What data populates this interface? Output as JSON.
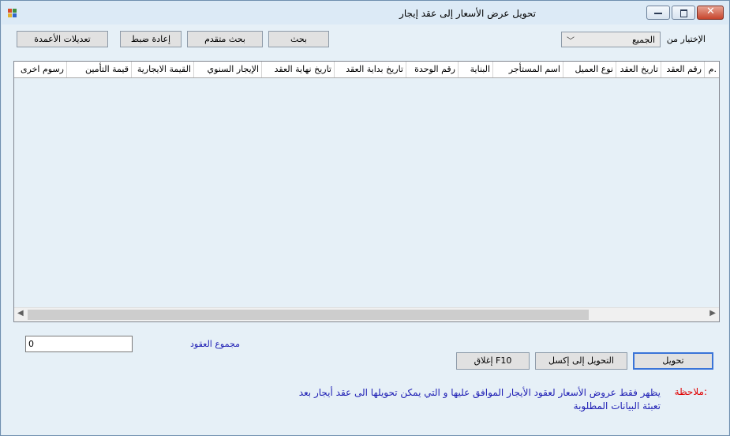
{
  "window": {
    "title": "تحويل عرض الأسعار إلى عقد إيجار"
  },
  "toolbar": {
    "column_edits_label": "تعديلات الأعمدة",
    "reset_label": "إعادة ضبط",
    "advanced_search_label": "بحث متقدم",
    "search_label": "بحث"
  },
  "filter": {
    "label": "الإختيار من",
    "selected": "الجميع"
  },
  "table": {
    "columns": [
      "م.",
      "رقم العقد",
      "تاريخ العقد",
      "نوع العميل",
      "اسم المستأجر",
      "البناية",
      "رقم الوحدة",
      "تاريخ بداية العقد",
      "تاريخ نهاية العقد",
      "الإيجار السنوي",
      "القيمة الايجارية",
      "قيمة التأمين",
      "رسوم اخرى"
    ]
  },
  "summary": {
    "total_label": "مجموع العقود",
    "total_value": "0"
  },
  "actions": {
    "convert_label": "تحويل",
    "excel_label": "التحويل إلى إكسل",
    "close_label": "إغلاق F10"
  },
  "note": {
    "label": "ملاحظة:",
    "text": "يظهر فقط عروض الأسعار لعقود الأيجار الموافق عليها و التي يمكن تحويلها الى عقد أيجار بعد تعبئة البيانات المطلوبة"
  },
  "colors": {
    "window_bg": "#e6f0f7",
    "note_label": "#e00000",
    "note_text": "#1e1eb4",
    "label_blue": "#1e1eb4"
  }
}
